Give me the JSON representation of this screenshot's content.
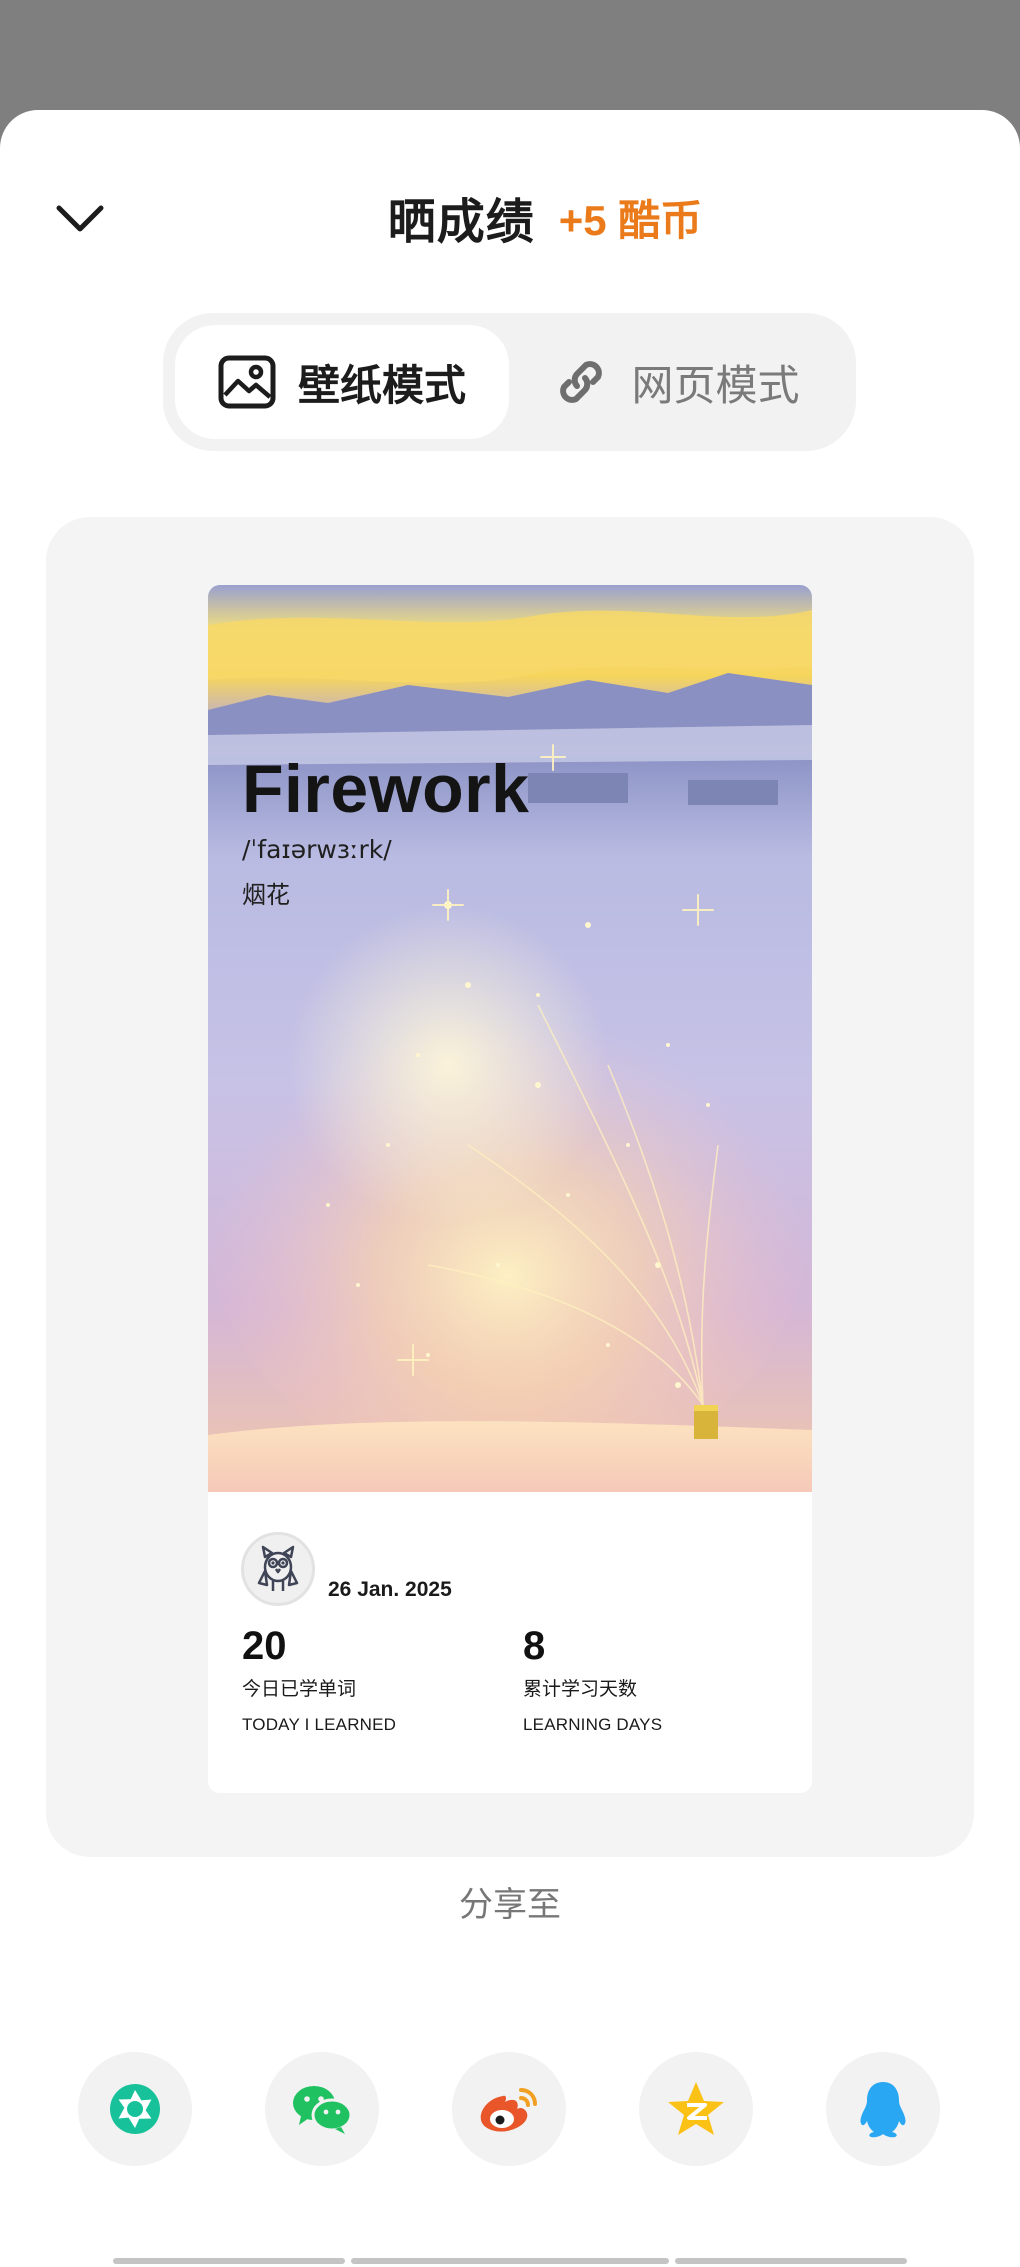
{
  "header": {
    "title": "晒成绩",
    "reward": "+5 酷币"
  },
  "modes": [
    {
      "label": "壁纸模式",
      "icon": "image-icon",
      "active": true
    },
    {
      "label": "网页模式",
      "icon": "link-icon",
      "active": false
    }
  ],
  "card": {
    "word": "Firework",
    "phonetic": "/ˈfaɪərwɜːrk/",
    "meaning": "烟花",
    "date": "26 Jan. 2025",
    "stats": [
      {
        "value": "20",
        "label_cn": "今日已学单词",
        "label_en": "TODAY I LEARNED"
      },
      {
        "value": "8",
        "label_cn": "累计学习天数",
        "label_en": "LEARNING DAYS"
      }
    ]
  },
  "share": {
    "label": "分享至",
    "targets": [
      {
        "name": "moments",
        "icon": "camera-shutter-icon",
        "color": "#17c29a"
      },
      {
        "name": "wechat",
        "icon": "wechat-icon",
        "color": "#1fc160"
      },
      {
        "name": "weibo",
        "icon": "weibo-icon",
        "color": "#e8562a"
      },
      {
        "name": "qzone",
        "icon": "qzone-star-icon",
        "color": "#fbc115"
      },
      {
        "name": "qq",
        "icon": "qq-penguin-icon",
        "color": "#2aa7f2"
      }
    ]
  },
  "colors": {
    "accent": "#ea7a1a",
    "overlay": "#7f7f7f"
  }
}
